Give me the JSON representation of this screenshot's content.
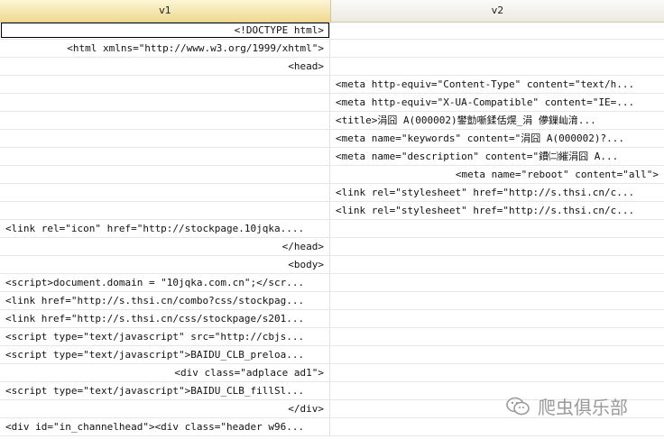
{
  "columns": {
    "v1": "v1",
    "v2": "v2"
  },
  "rows": [
    {
      "v1": "<!DOCTYPE html>",
      "v2": ""
    },
    {
      "v1": "<html xmlns=\"http://www.w3.org/1999/xhtml\">",
      "v2": ""
    },
    {
      "v1": "<head>",
      "v2": ""
    },
    {
      "v1": "",
      "v2": "<meta http-equiv=\"Content-Type\" content=\"text/h..."
    },
    {
      "v1": "",
      "v2": "<meta http-equiv=\"X-UA-Compatible\" content=\"IE=..."
    },
    {
      "v1": "",
      "v2": "<title>涓囧  A(000002)鐢勯噺鍒佸熀_涓  儚鏁屾湇..."
    },
    {
      "v1": "",
      "v2": "<meta name=\"keywords\" content=\"涓囧  A(000002)?..."
    },
    {
      "v1": "",
      "v2": "<meta name=\"description\" content=\"鐨㈡繀涓囧  A..."
    },
    {
      "v1": "",
      "v2": "<meta name=\"reboot\" content=\"all\">"
    },
    {
      "v1": "",
      "v2": "<link rel=\"stylesheet\" href=\"http://s.thsi.cn/c..."
    },
    {
      "v1": "",
      "v2": "<link rel=\"stylesheet\" href=\"http://s.thsi.cn/c..."
    },
    {
      "v1": "<link rel=\"icon\" href=\"http://stockpage.10jqka....",
      "v2": ""
    },
    {
      "v1": "</head>",
      "v2": ""
    },
    {
      "v1": "<body>",
      "v2": ""
    },
    {
      "v1": "<script>document.domain = \"10jqka.com.cn\";</scr...",
      "v2": ""
    },
    {
      "v1": "<link href=\"http://s.thsi.cn/combo?css/stockpag...",
      "v2": ""
    },
    {
      "v1": "<link href=\"http://s.thsi.cn/css/stockpage/s201...",
      "v2": ""
    },
    {
      "v1": "<script type=\"text/javascript\" src=\"http://cbjs...",
      "v2": ""
    },
    {
      "v1": "<script type=\"text/javascript\">BAIDU_CLB_preloa...",
      "v2": ""
    },
    {
      "v1": "<div class=\"adplace ad1\">",
      "v2": ""
    },
    {
      "v1": "<script type=\"text/javascript\">BAIDU_CLB_fillSl...",
      "v2": ""
    },
    {
      "v1": "</div>",
      "v2": ""
    },
    {
      "v1": "<div id=\"in_channelhead\"><div class=\"header w96...",
      "v2": ""
    }
  ],
  "watermark": {
    "text": "爬虫俱乐部",
    "icon": "wechat-icon"
  }
}
